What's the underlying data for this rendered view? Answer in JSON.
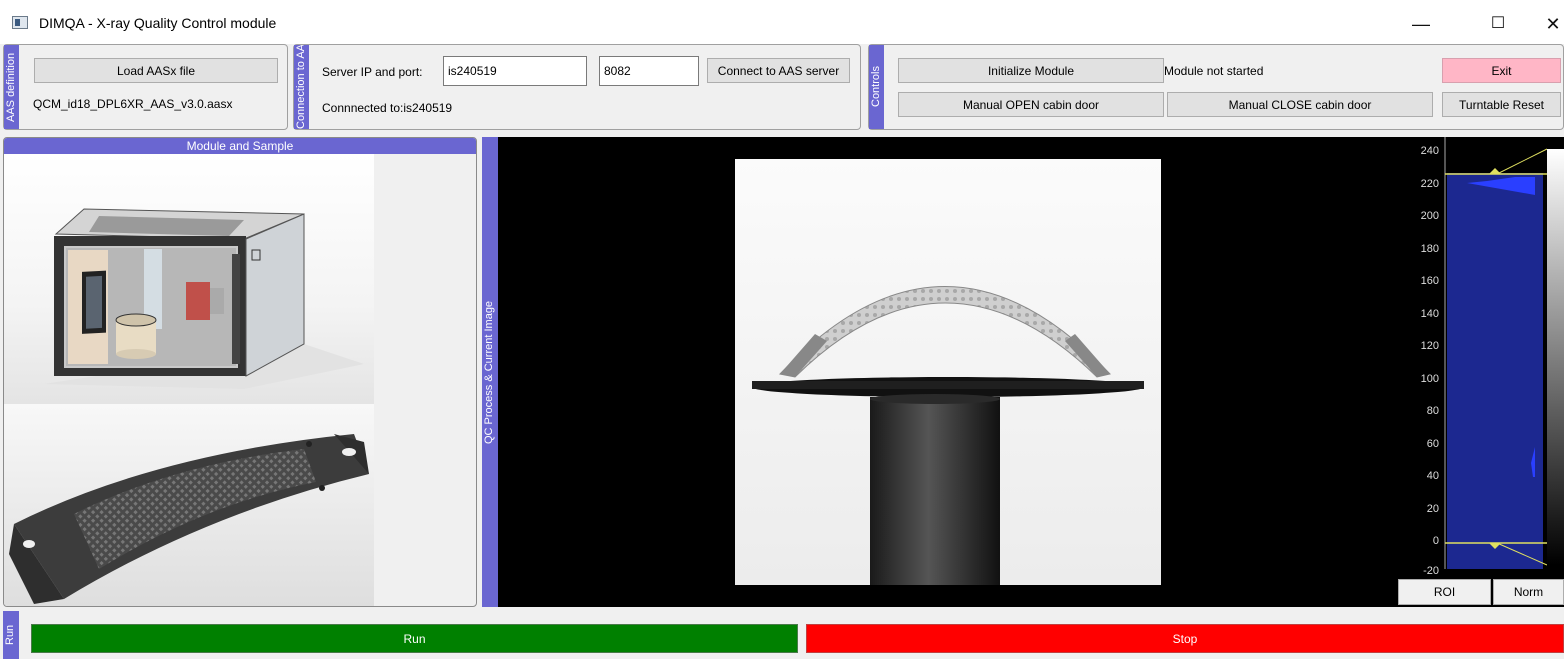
{
  "window": {
    "title": "DIMQA - X-ray Quality Control module",
    "minimize_glyph": "—",
    "maximize_glyph": "☐",
    "close_glyph": "✕"
  },
  "aas_definition": {
    "section_label": "AAS definition",
    "load_button": "Load AASx file",
    "loaded_file": "QCM_id18_DPL6XR_AAS_v3.0.aasx"
  },
  "aas_connection": {
    "section_label": "Connection to AAS server",
    "server_label": "Server IP and port:",
    "server_ip": "is240519",
    "server_port": "8082",
    "connect_button": "Connect to AAS server",
    "connection_status": "Connnected to:is240519"
  },
  "controls": {
    "section_label": "Controls",
    "initialize_button": "Initialize Module",
    "module_status": "Module not started",
    "exit_button": "Exit",
    "open_door_button": "Manual OPEN cabin door",
    "close_door_button": "Manual CLOSE cabin door",
    "turntable_reset_button": "Turntable Reset"
  },
  "module_panel": {
    "title": "Module and Sample"
  },
  "qc_panel": {
    "section_label": "QC Process & Current Image",
    "histogram_ticks": [
      "240",
      "220",
      "200",
      "180",
      "160",
      "140",
      "120",
      "100",
      "80",
      "60",
      "40",
      "20",
      "0",
      "-20"
    ],
    "roi_button": "ROI",
    "norm_button": "Norm"
  },
  "run_section": {
    "section_label": "Run",
    "run_button": "Run",
    "stop_button": "Stop"
  },
  "colors": {
    "section_strip": "#6a66d1",
    "run": "#008000",
    "stop": "#ff0000",
    "exit": "#ffb6c6",
    "histogram_fill": "#1e2a8c"
  }
}
